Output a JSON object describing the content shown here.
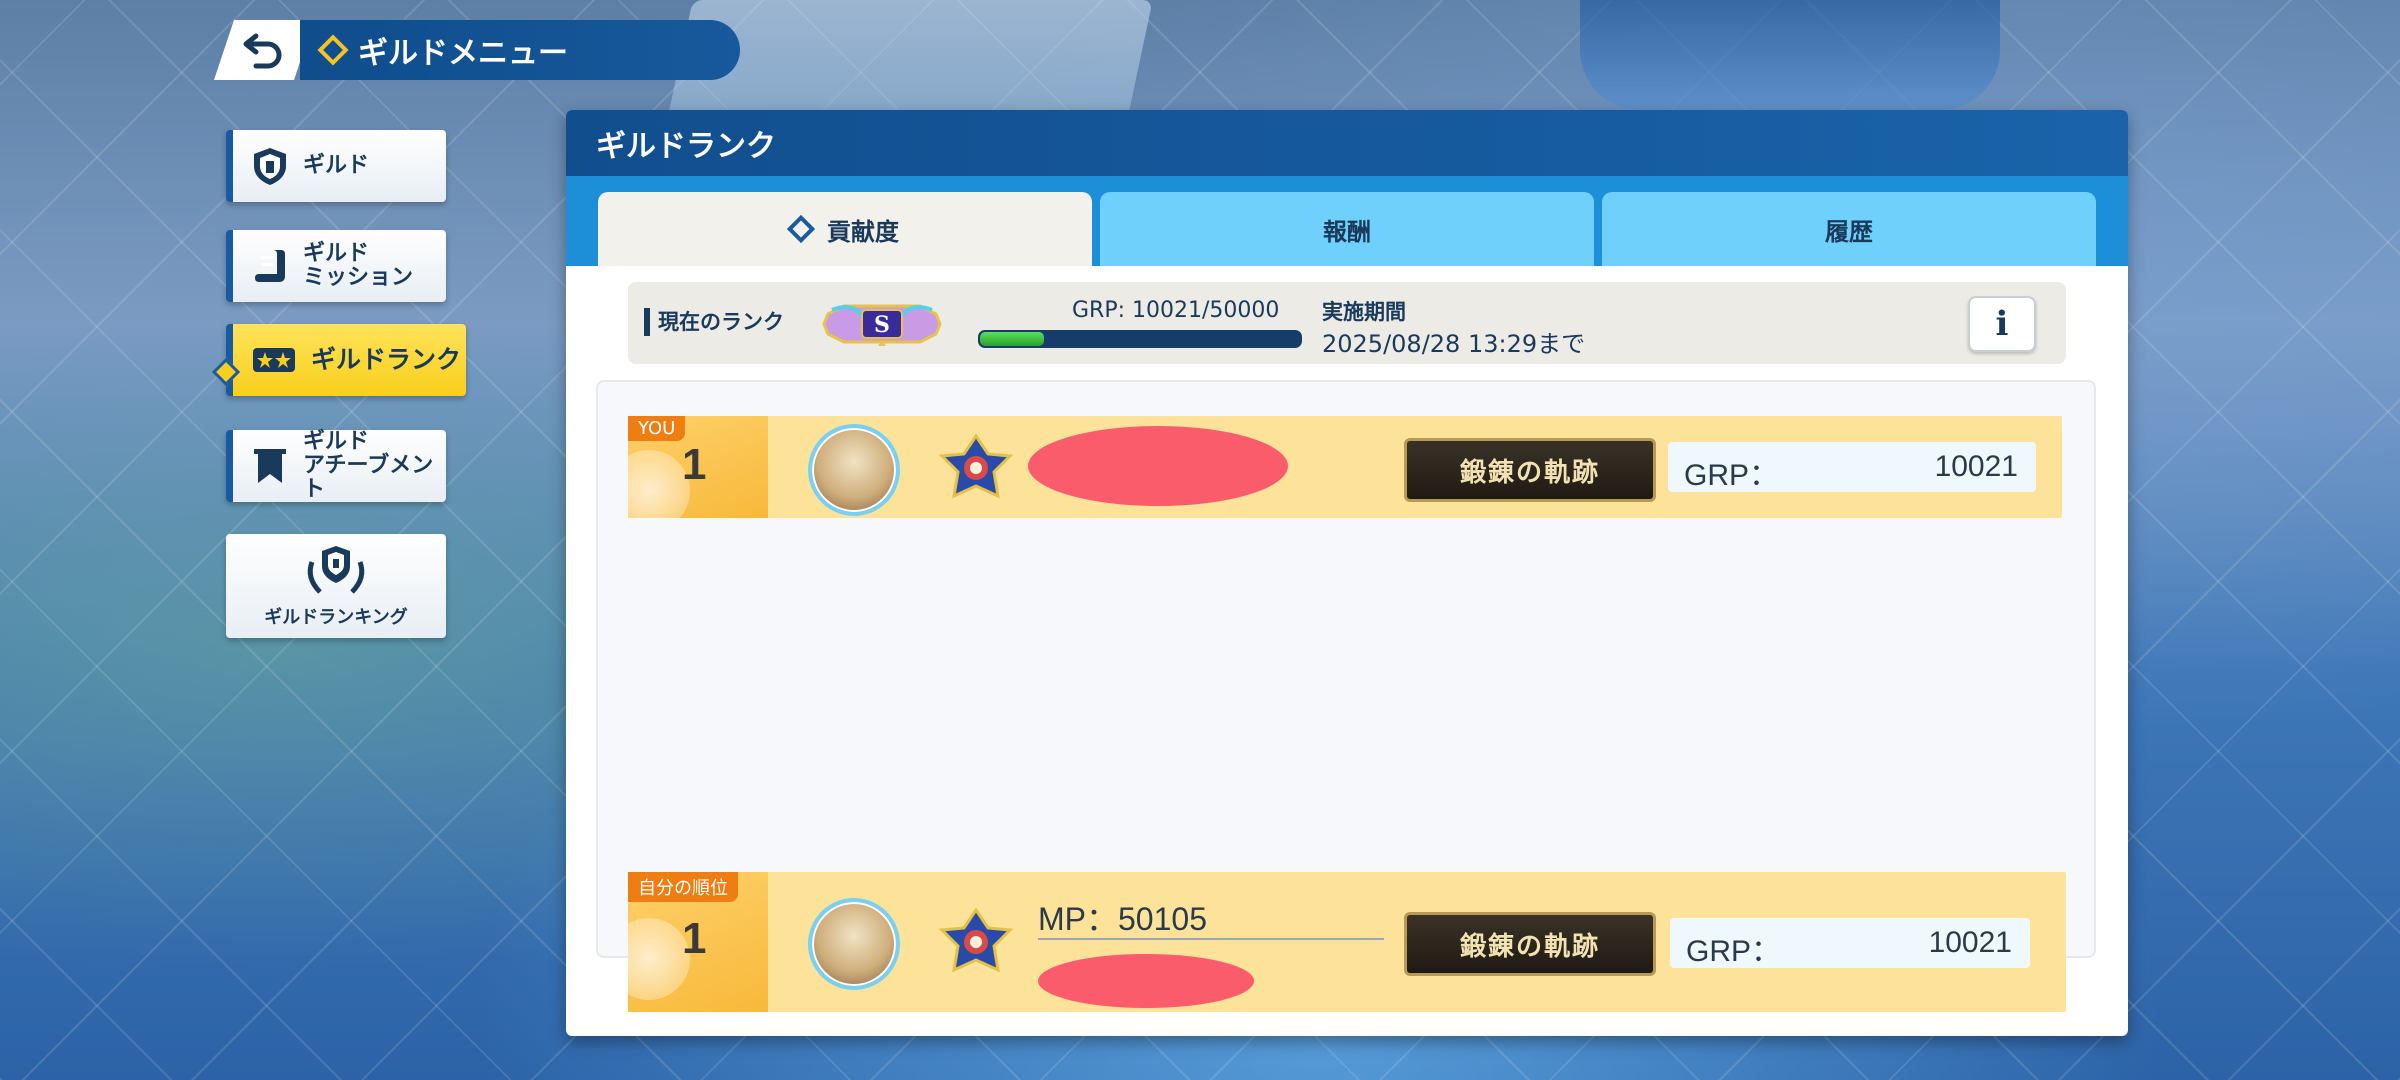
{
  "header": {
    "title": "ギルドメニュー"
  },
  "sidebar": {
    "items": [
      {
        "label": "ギルド"
      },
      {
        "label": "ギルド\nミッション"
      },
      {
        "label": "ギルドランク"
      },
      {
        "label": "ギルド\nアチーブメント"
      },
      {
        "label": "ギルドランキング"
      }
    ]
  },
  "panel": {
    "title": "ギルドランク",
    "tabs": [
      {
        "label": "貢献度",
        "active": true
      },
      {
        "label": "報酬",
        "active": false
      },
      {
        "label": "履歴",
        "active": false
      }
    ]
  },
  "current_rank": {
    "label": "現在のランク",
    "rank_letter": "S",
    "grp_text": "GRP: 10021/50000",
    "grp_value": 10021,
    "grp_max": 50000,
    "progress_fraction": 0.2,
    "period_label": "実施期間",
    "period_value": "2025/08/28 13:29まで",
    "info_label": "i"
  },
  "ranking_rows": [
    {
      "tag": "YOU",
      "rank": "1",
      "title": "鍛錬の軌跡",
      "grp_label": "GRP：",
      "grp_value": "10021"
    }
  ],
  "self_row": {
    "tag": "自分の順位",
    "rank": "1",
    "mp_text": "MP：50105",
    "title": "鍛錬の軌跡",
    "grp_label": "GRP：",
    "grp_value": "10021"
  },
  "colors": {
    "header_blue": "#114e8e",
    "tab_strip": "#1d8fd8",
    "tab_inactive": "#6fd0fb",
    "active_nav": "#f8cf1c",
    "row_bg": "#fde39a",
    "tag_orange": "#f07d12",
    "progress_green": "#2aa02a",
    "redaction": "#fb5c6c"
  },
  "icons": {
    "back": "back-arrow-icon",
    "guild": "guild-shield-icon",
    "mission": "scroll-icon",
    "rank": "star-rank-icon",
    "achievement": "banner-icon",
    "ranking": "laurel-shield-icon"
  }
}
